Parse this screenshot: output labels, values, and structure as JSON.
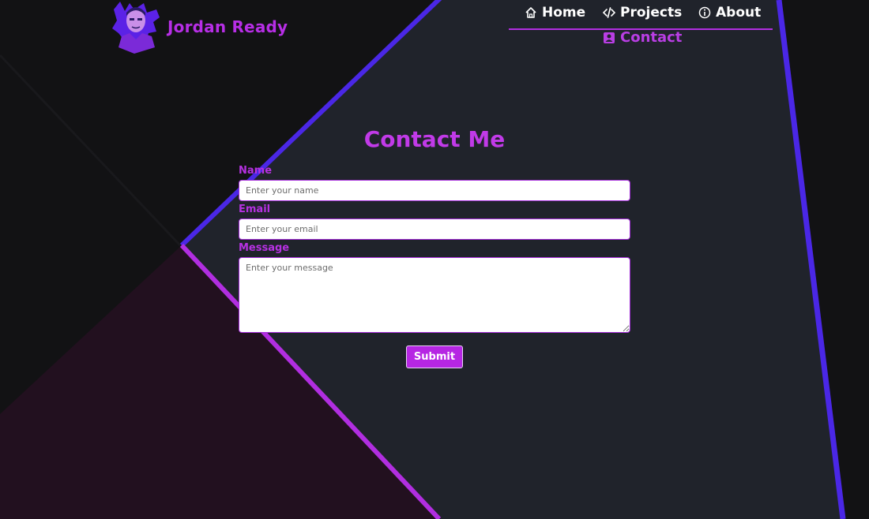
{
  "brand": {
    "name": "Jordan Ready",
    "avatar_icon": "developer-avatar"
  },
  "nav": {
    "home": "Home",
    "projects": "Projects",
    "about": "About",
    "contact": "Contact"
  },
  "contact": {
    "title": "Contact Me",
    "name_label": "Name",
    "name_placeholder": "Enter your name",
    "email_label": "Email",
    "email_placeholder": "Enter your email",
    "message_label": "Message",
    "message_placeholder": "Enter your message",
    "submit_label": "Submit"
  },
  "colors": {
    "accent": "#b72ee6",
    "indigo_stripe": "#4a27e6",
    "panel": "#20232b",
    "background": "#121214",
    "purple_shade": "#22101f"
  }
}
